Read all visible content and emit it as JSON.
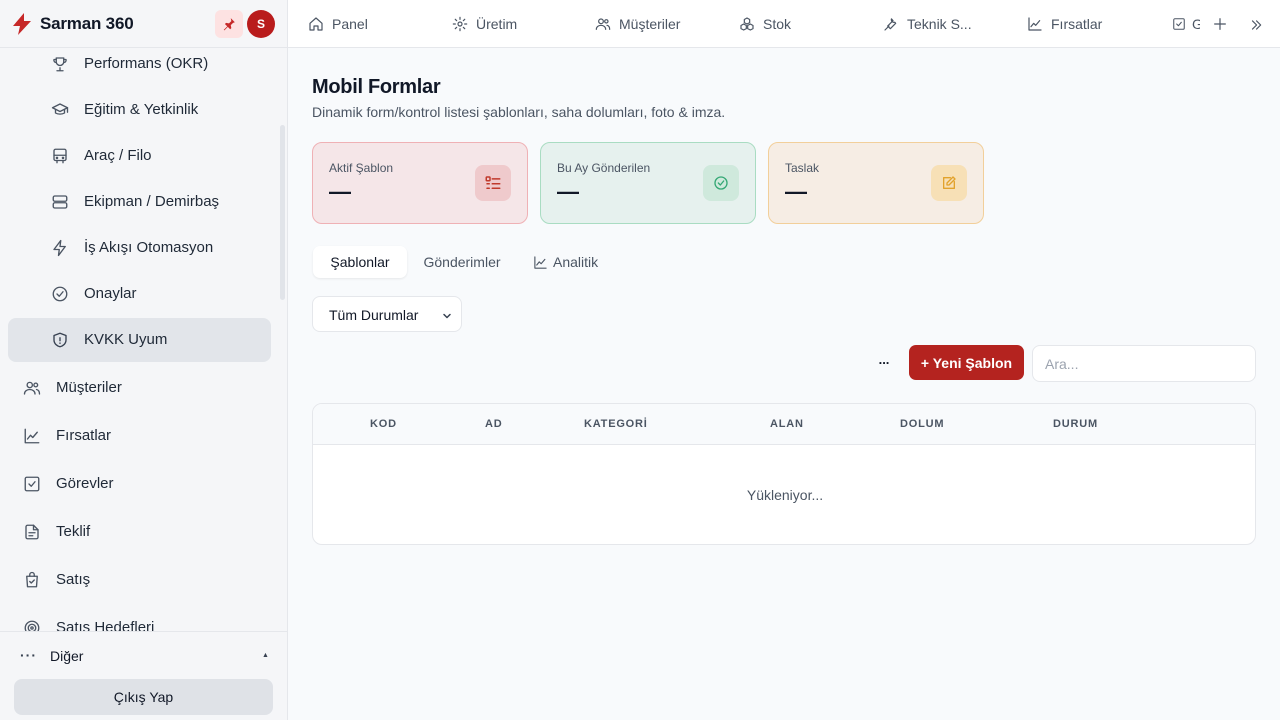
{
  "app": {
    "name": "Sarman 360",
    "avatar_initial": "S"
  },
  "sidebar": {
    "sub_items": [
      {
        "label": "Performans (OKR)",
        "icon": "trophy-icon"
      },
      {
        "label": "Eğitim & Yetkinlik",
        "icon": "graduation-cap-icon"
      },
      {
        "label": "Araç / Filo",
        "icon": "bus-icon"
      },
      {
        "label": "Ekipman / Demirbaş",
        "icon": "server-icon"
      },
      {
        "label": "İş Akışı Otomasyon",
        "icon": "zap-icon"
      },
      {
        "label": "Onaylar",
        "icon": "check-circle-icon"
      },
      {
        "label": "KVKK Uyum",
        "icon": "shield-icon",
        "active": true
      }
    ],
    "main_items": [
      {
        "label": "Müşteriler",
        "icon": "users-icon"
      },
      {
        "label": "Fırsatlar",
        "icon": "trending-up-icon"
      },
      {
        "label": "Görevler",
        "icon": "check-square-icon"
      },
      {
        "label": "Teklif",
        "icon": "file-text-icon"
      },
      {
        "label": "Satış",
        "icon": "shopping-bag-icon"
      },
      {
        "label": "Satış Hedefleri",
        "icon": "target-icon"
      }
    ],
    "other_label": "Diğer",
    "logout_label": "Çıkış Yap"
  },
  "topbar": {
    "tabs": [
      {
        "label": "Panel",
        "icon": "home-icon"
      },
      {
        "label": "Üretim",
        "icon": "gear-icon"
      },
      {
        "label": "Müşteriler",
        "icon": "users-icon"
      },
      {
        "label": "Stok",
        "icon": "boxes-icon"
      },
      {
        "label": "Teknik S...",
        "icon": "wrench-icon"
      },
      {
        "label": "Fırsatlar",
        "icon": "trending-up-icon"
      },
      {
        "label": "G",
        "icon": "check-square-icon"
      }
    ]
  },
  "page": {
    "title": "Mobil Formlar",
    "subtitle": "Dinamik form/kontrol listesi şablonları, saha dolumları, foto & imza."
  },
  "stats": [
    {
      "label": "Aktif Şablon",
      "value": "—",
      "icon": "list-checks-icon",
      "color": "#c0392b"
    },
    {
      "label": "Bu Ay Gönderilen",
      "value": "—",
      "icon": "check-circle-icon",
      "color": "#34a874"
    },
    {
      "label": "Taslak",
      "value": "—",
      "icon": "edit-icon",
      "color": "#e2a22b"
    }
  ],
  "tabs": [
    {
      "label": "Şablonlar",
      "active": true
    },
    {
      "label": "Gönderimler"
    },
    {
      "label": "Analitik",
      "icon": "chart-line-icon"
    }
  ],
  "filter": {
    "status_value": "Tüm Durumlar"
  },
  "toolbar": {
    "more_label": "...",
    "new_label": "+ Yeni Şablon",
    "search_placeholder": "Ara..."
  },
  "table": {
    "columns": [
      "KOD",
      "AD",
      "KATEGORİ",
      "ALAN",
      "DOLUM",
      "DURUM"
    ],
    "loading_text": "Yükleniyor..."
  },
  "colors": {
    "accent": "#b4231f",
    "sidebar_bg": "#f5f6f8",
    "active_item_bg": "#e2e5ea"
  }
}
